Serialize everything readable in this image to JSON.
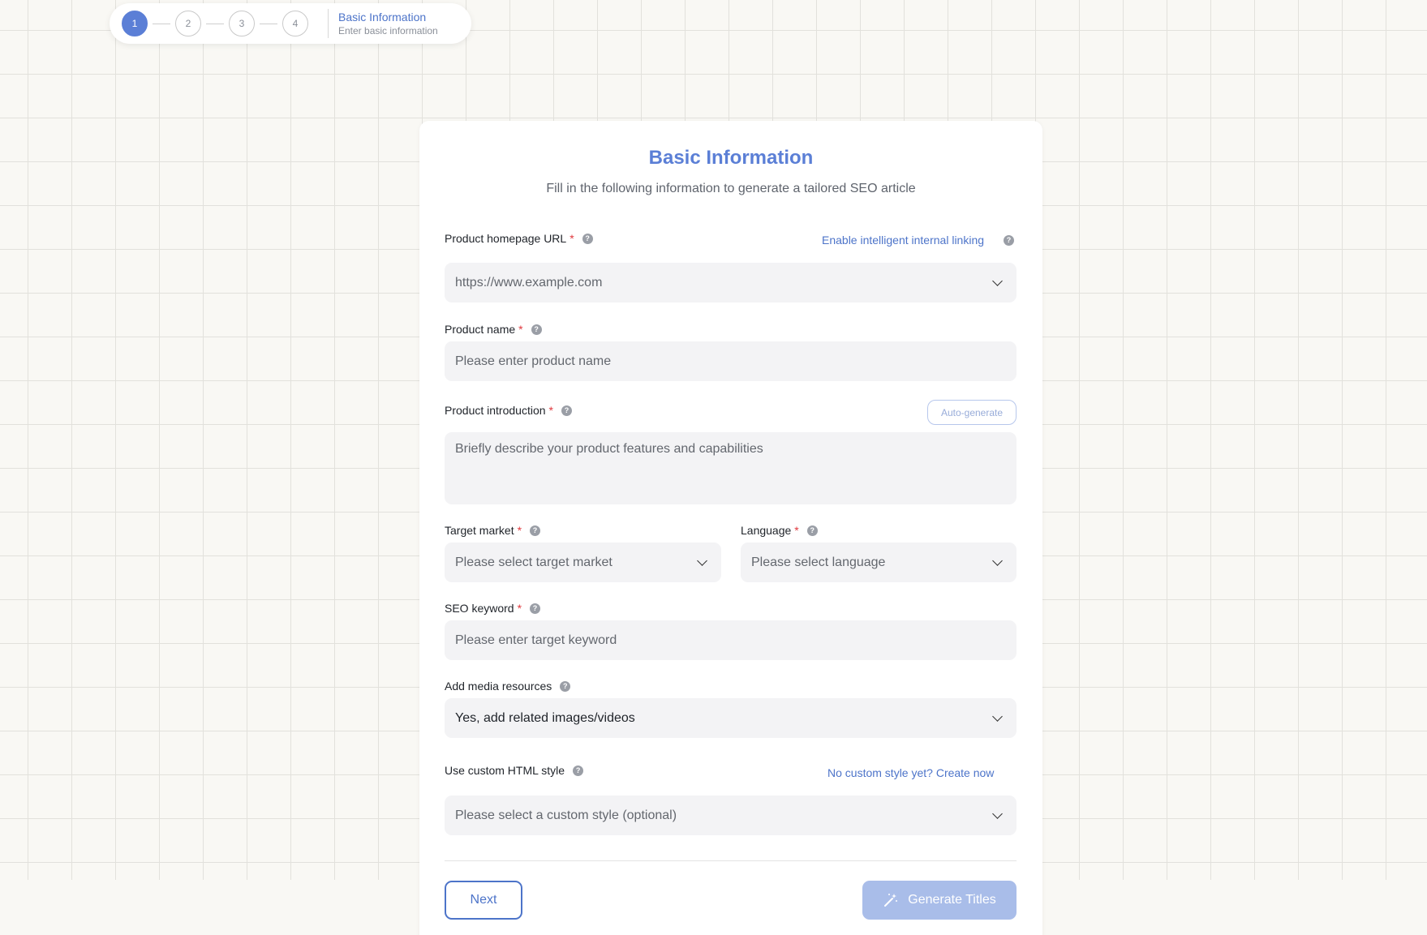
{
  "stepper": {
    "steps": [
      "1",
      "2",
      "3",
      "4"
    ],
    "active_step": 1,
    "current_title": "Basic Information",
    "current_subtitle": "Enter basic information"
  },
  "form": {
    "title": "Basic Information",
    "subtitle": "Fill in the following information to generate a tailored SEO article",
    "homepage_url": {
      "label": "Product homepage URL",
      "required": "*",
      "link": "Enable intelligent internal linking",
      "placeholder": "https://www.example.com"
    },
    "product_name": {
      "label": "Product name",
      "required": "*",
      "placeholder": "Please enter product name"
    },
    "product_intro": {
      "label": "Product introduction",
      "required": "*",
      "auto_generate": "Auto-generate",
      "placeholder": "Briefly describe your product features and capabilities"
    },
    "target_market": {
      "label": "Target market",
      "required": "*",
      "placeholder": "Please select target market"
    },
    "language": {
      "label": "Language",
      "required": "*",
      "placeholder": "Please select language"
    },
    "seo_keyword": {
      "label": "SEO keyword",
      "required": "*",
      "placeholder": "Please enter target keyword"
    },
    "media": {
      "label": "Add media resources",
      "value": "Yes, add related images/videos"
    },
    "custom_style": {
      "label": "Use custom HTML style",
      "link": "No custom style yet? Create now",
      "placeholder": "Please select a custom style (optional)"
    },
    "help_icon_glyph": "?",
    "buttons": {
      "next": "Next",
      "generate": "Generate Titles"
    }
  },
  "colors": {
    "accent": "#5b7fd6",
    "link": "#4d74c9",
    "required": "#e0393e",
    "field_bg": "#f3f3f5",
    "page_bg": "#f9f8f4",
    "generate_disabled": "#a9bde9"
  }
}
